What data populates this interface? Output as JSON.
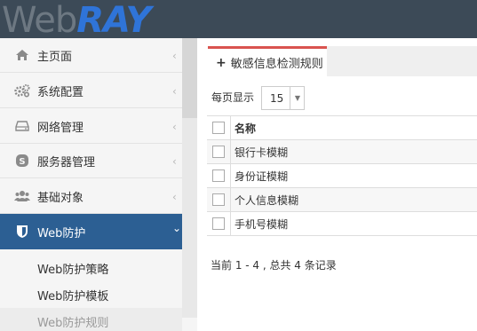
{
  "header": {
    "logo_web": "Web",
    "logo_ray": "RAY"
  },
  "sidebar": {
    "items": [
      {
        "label": "主页面",
        "icon": "home-icon"
      },
      {
        "label": "系统配置",
        "icon": "gears-icon"
      },
      {
        "label": "网络管理",
        "icon": "drive-icon"
      },
      {
        "label": "服务器管理",
        "icon": "skype-icon"
      },
      {
        "label": "基础对象",
        "icon": "users-icon"
      },
      {
        "label": "Web防护",
        "icon": "shield-icon",
        "active": true
      }
    ],
    "chevron_collapsed": "‹",
    "chevron_expanded": "⌄",
    "subitems": [
      {
        "label": "Web防护策略"
      },
      {
        "label": "Web防护模板"
      },
      {
        "label": "Web防护规则"
      }
    ]
  },
  "main": {
    "tab": {
      "plus": "+",
      "label": "敏感信息检测规则"
    },
    "perpage_label": "每页显示",
    "perpage_value": "15",
    "table": {
      "header": "名称",
      "rows": [
        "银行卡模糊",
        "身份证模糊",
        "个人信息模糊",
        "手机号模糊"
      ]
    },
    "footer": "当前 1 - 4 , 总共 4 条记录"
  },
  "colors": {
    "header_bg": "#3c4a57",
    "active_bg": "#2c5f93",
    "tab_accent": "#d9534f",
    "logo_blue": "#2f74d8"
  }
}
